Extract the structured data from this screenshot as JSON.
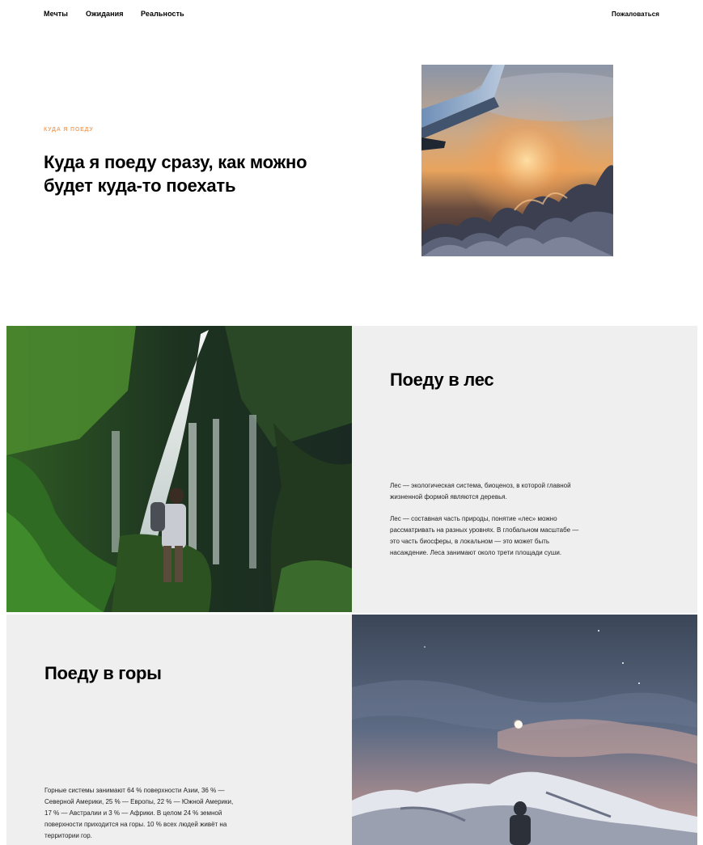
{
  "nav": {
    "links": [
      "Мечты",
      "Ожидания",
      "Реальность"
    ],
    "complain": "Пожаловаться"
  },
  "hero": {
    "eyebrow": "Куда я поеду",
    "title": "Куда я поеду сразу, как можно будет куда-то поехать"
  },
  "forest": {
    "title": "Поеду в лес",
    "paragraph1": "Лес — экологическая система, биоценоз, в которой главной жизненной формой являются деревья.",
    "paragraph2": "Лес — составная часть природы, понятие «лес» можно рассматривать на разных уровнях. В глобальном масштабе — это часть биосферы, в локальном — это может быть насаждение. Леса занимают около трети площади суши."
  },
  "mountains": {
    "title": "Поеду в горы",
    "paragraph": "Горные системы занимают 64 % поверхности Азии, 36 % — Северной Америки, 25 % — Европы, 22 % — Южной Америки, 17 % — Австралии и 3 % — Африки. В целом 24 % земной поверхности приходится на горы. 10 % всех людей живёт на территории гор."
  },
  "colors": {
    "accent": "#f0a56a",
    "panel_bg": "#efefef"
  }
}
